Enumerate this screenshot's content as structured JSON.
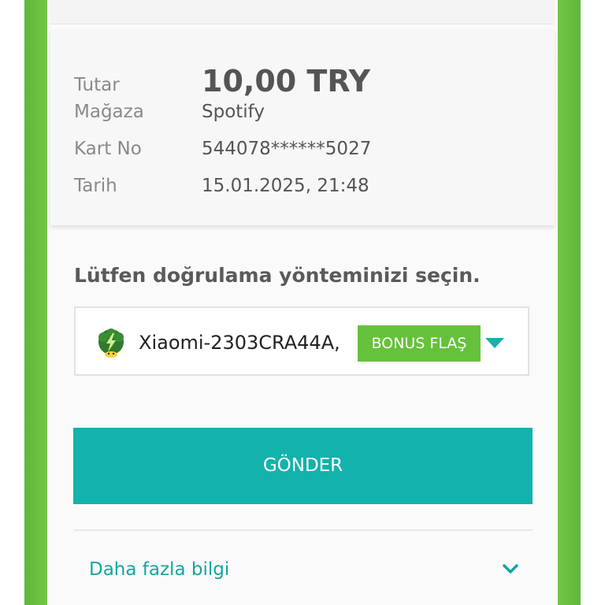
{
  "transaction": {
    "amount_label": "Tutar",
    "amount_value": "10,00 TRY",
    "merchant_label": "Mağaza",
    "merchant_value": "Spotify",
    "card_label": "Kart No",
    "card_value": "544078******5027",
    "date_label": "Tarih",
    "date_value": "15.01.2025, 21:48"
  },
  "verification": {
    "prompt": "Lütfen doğrulama yönteminizi seçin.",
    "selected_device": "Xiaomi-2303CRA44A,",
    "badge": "BONUS FLAŞ",
    "device_icon": "bonus-flash-icon",
    "caret_icon": "caret-down-icon"
  },
  "actions": {
    "send_label": "GÖNDER"
  },
  "more": {
    "label": "Daha fazla bilgi",
    "chevron_icon": "chevron-down-icon"
  },
  "colors": {
    "brand_green": "#66c13c",
    "teal": "#14b2ad"
  }
}
